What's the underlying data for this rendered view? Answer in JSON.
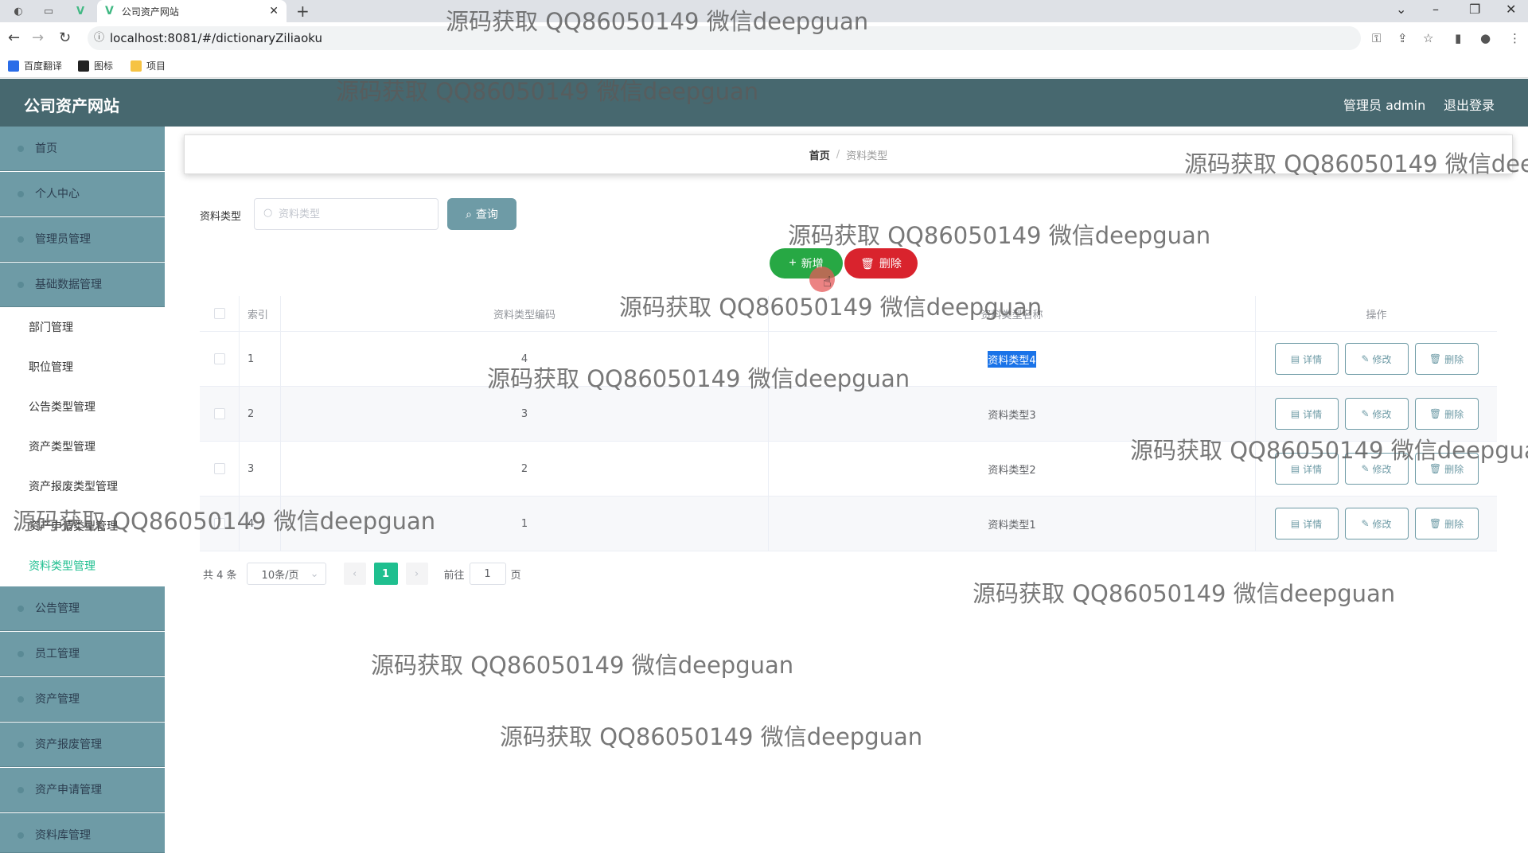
{
  "browser": {
    "tab_title": "公司资产网站",
    "url": "localhost:8081/#/dictionaryZiliaoku",
    "bookmarks": [
      "百度翻译",
      "图标",
      "项目"
    ]
  },
  "header": {
    "title": "公司资产网站",
    "user": "管理员 admin",
    "logout": "退出登录",
    "bg_color": "#47686f"
  },
  "sidebar": {
    "items_top": [
      "首页",
      "个人中心",
      "管理员管理",
      "基础数据管理"
    ],
    "sub_items": [
      "部门管理",
      "职位管理",
      "公告类型管理",
      "资产类型管理",
      "资产报废类型管理",
      "资产申请类型管理",
      "资料类型管理"
    ],
    "active_sub": "资料类型管理",
    "items_bottom": [
      "公告管理",
      "员工管理",
      "资产管理",
      "资产报废管理",
      "资产申请管理",
      "资料库管理"
    ],
    "menu_color": "#6e9ba6"
  },
  "breadcrumb": {
    "home": "首页",
    "separator": "/",
    "current": "资料类型"
  },
  "search": {
    "label": "资料类型",
    "placeholder": "资料类型",
    "value": "",
    "button": "查询"
  },
  "actions": {
    "add": "新增",
    "delete": "删除"
  },
  "table": {
    "headers": {
      "index": "索引",
      "code": "资料类型编码",
      "name": "资料类型名称",
      "ops": "操作"
    },
    "rows": [
      {
        "index": "1",
        "code": "4",
        "name": "资料类型4",
        "selected_text": true
      },
      {
        "index": "2",
        "code": "3",
        "name": "资料类型3"
      },
      {
        "index": "3",
        "code": "2",
        "name": "资料类型2"
      },
      {
        "index": "4",
        "code": "1",
        "name": "资料类型1"
      }
    ],
    "op_labels": {
      "detail": "详情",
      "edit": "修改",
      "delete": "删除"
    }
  },
  "pagination": {
    "total": "共 4 条",
    "page_size": "10条/页",
    "current_page": "1",
    "goto_label": "前往",
    "goto_value": "1",
    "page_suffix": "页"
  },
  "watermark": "源码获取 QQ86050149 微信deepguan"
}
